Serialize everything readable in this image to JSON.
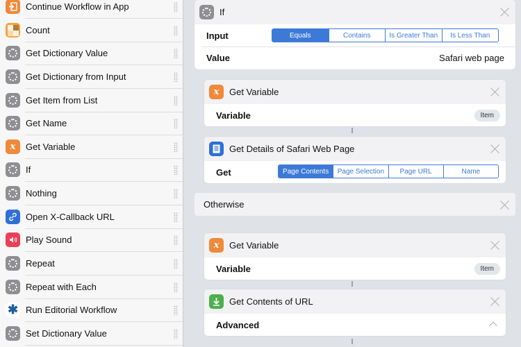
{
  "sidebar": {
    "items": [
      {
        "label": "Continue Workflow in App",
        "icon": "continue-workflow-icon"
      },
      {
        "label": "Count",
        "icon": "calculator-icon"
      },
      {
        "label": "Get Dictionary Value",
        "icon": "gear-icon"
      },
      {
        "label": "Get Dictionary from Input",
        "icon": "gear-icon"
      },
      {
        "label": "Get Item from List",
        "icon": "gear-icon"
      },
      {
        "label": "Get Name",
        "icon": "gear-icon"
      },
      {
        "label": "Get Variable",
        "icon": "variable-icon"
      },
      {
        "label": "If",
        "icon": "gear-icon"
      },
      {
        "label": "Nothing",
        "icon": "gear-icon"
      },
      {
        "label": "Open X-Callback URL",
        "icon": "link-icon"
      },
      {
        "label": "Play Sound",
        "icon": "speaker-icon"
      },
      {
        "label": "Repeat",
        "icon": "gear-icon"
      },
      {
        "label": "Repeat with Each",
        "icon": "gear-icon"
      },
      {
        "label": "Run Editorial Workflow",
        "icon": "editorial-icon"
      },
      {
        "label": "Set Dictionary Value",
        "icon": "gear-icon"
      }
    ]
  },
  "if_card": {
    "title": "If",
    "input_label": "Input",
    "input_options": [
      "Equals",
      "Contains",
      "Is Greater Than",
      "Is Less Than"
    ],
    "input_selected": "Equals",
    "value_label": "Value",
    "value": "Safari web page"
  },
  "get_variable_1": {
    "title": "Get Variable",
    "variable_label": "Variable",
    "variable_value": "Item"
  },
  "safari_card": {
    "title": "Get Details of Safari Web Page",
    "get_label": "Get",
    "options": [
      "Page Contents",
      "Page Selection",
      "Page URL",
      "Name"
    ],
    "selected": "Page Contents"
  },
  "otherwise": {
    "label": "Otherwise"
  },
  "get_variable_2": {
    "title": "Get Variable",
    "variable_label": "Variable",
    "variable_value": "Item"
  },
  "contents_card": {
    "title": "Get Contents of URL",
    "advanced_label": "Advanced"
  },
  "colors": {
    "accent": "#3d7ad8",
    "variable_orange": "#f0893a",
    "download_green": "#4cb04c"
  }
}
